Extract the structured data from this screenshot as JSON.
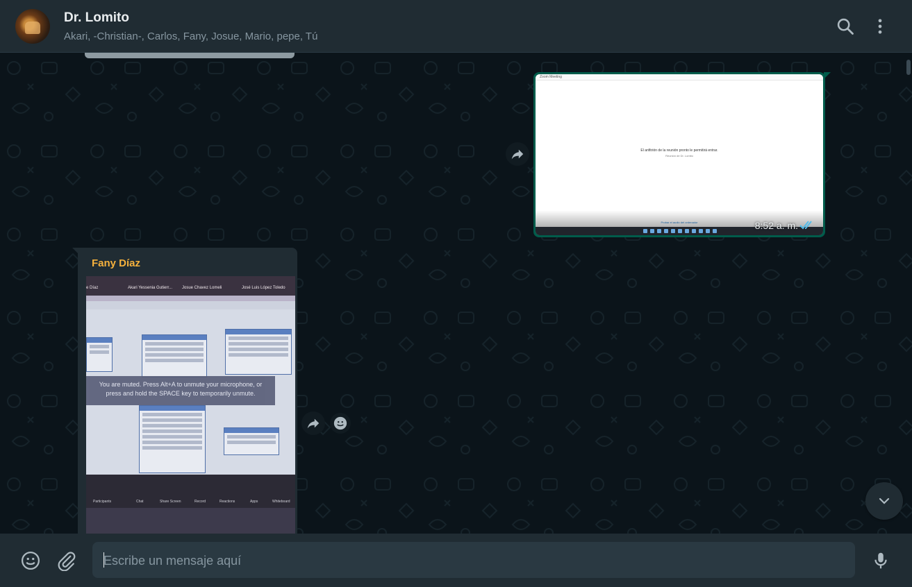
{
  "header": {
    "title": "Dr. Lomito",
    "subtitle": "Akari, -Christian-, Carlos, Fany, Josue, Mario, pepe, Tú",
    "icons": [
      "search-icon",
      "menu-icon"
    ]
  },
  "messages": [
    {
      "direction": "outgoing",
      "type": "image",
      "time": "8:52 a. m.",
      "status": "read",
      "image_text": {
        "window_title": "Zoom Meeting",
        "center_line": "El anfitrión de la reunión pronto le permitirá entrar.",
        "center_sub": "Reunión de Dr. Lomito",
        "link": "Probar el audio del ordenador"
      }
    },
    {
      "direction": "incoming",
      "type": "image",
      "sender": "Fany Díaz",
      "image_text": {
        "participants": [
          "e Díaz",
          "Akari Yessenia Gutierr...",
          "Josue Chavez Lomeli",
          "José Luis López Toledo"
        ],
        "mute_notice": "You are muted. Press Alt+A to unmute your microphone, or press and hold the SPACE key to temporarily unmute.",
        "toolbar": [
          "Participants",
          "Chat",
          "Share Screen",
          "Record",
          "Reactions",
          "Apps",
          "Whiteboard"
        ]
      }
    }
  ],
  "composer": {
    "placeholder": "Escribe un mensaje aquí",
    "icons": [
      "emoji-icon",
      "attach-icon",
      "mic-icon"
    ]
  },
  "colors": {
    "header_bg": "#202c33",
    "chat_bg": "#0b141a",
    "outgoing_bubble": "#005c4b",
    "incoming_bubble": "#202c33",
    "sender_name": "#f5b13d",
    "read_ticks": "#53bdeb"
  }
}
